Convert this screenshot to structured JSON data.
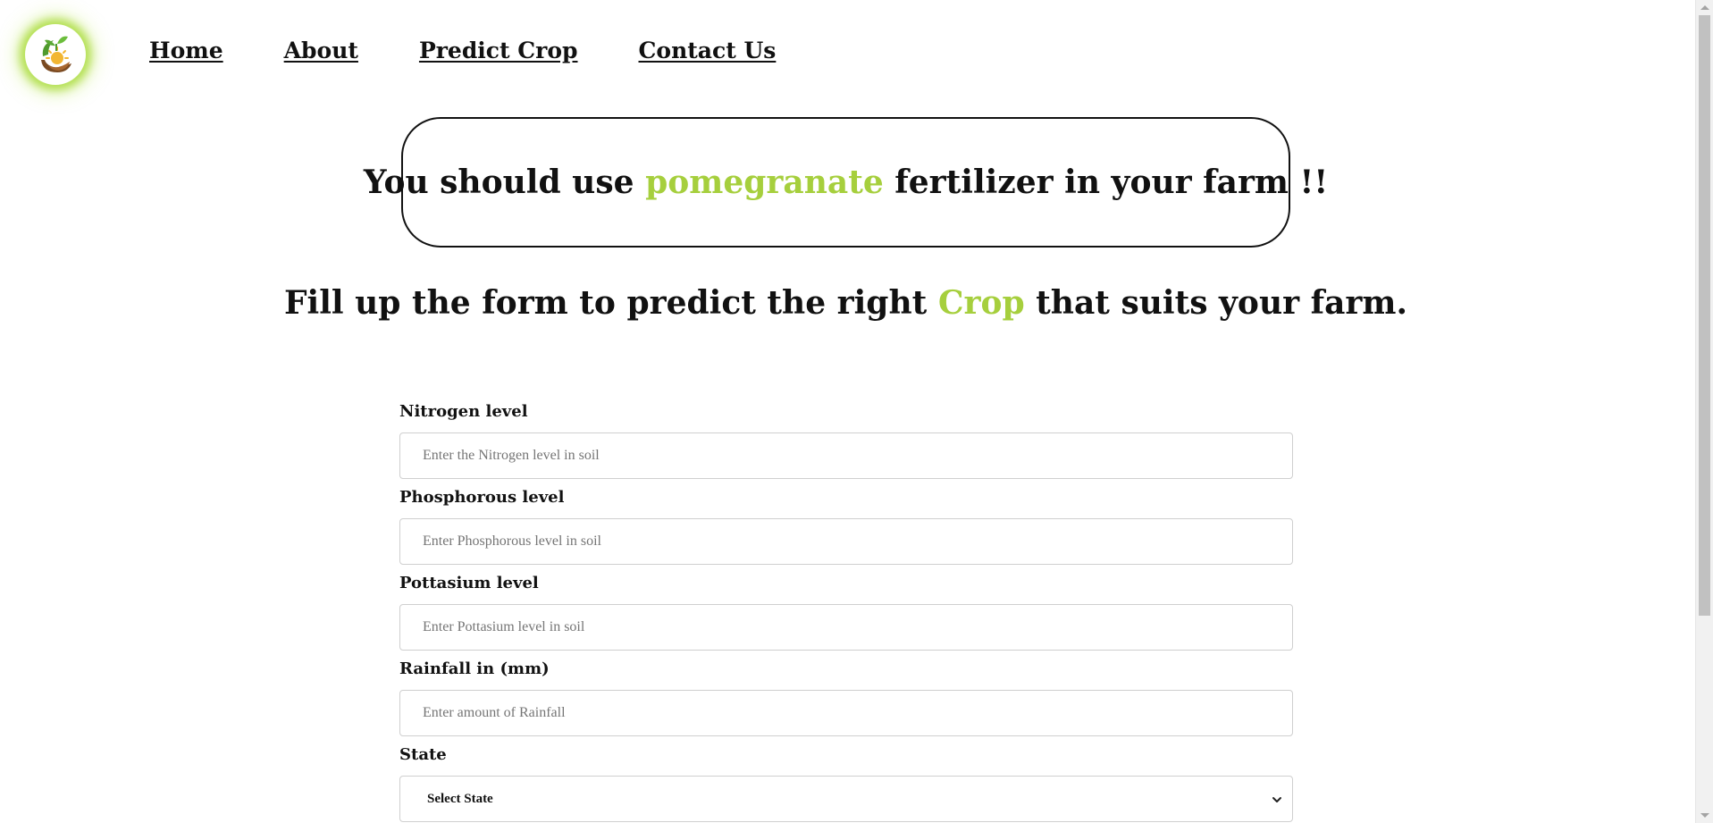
{
  "nav": {
    "items": [
      {
        "label": "Home"
      },
      {
        "label": "About"
      },
      {
        "label": "Predict Crop"
      },
      {
        "label": "Contact Us"
      }
    ]
  },
  "result": {
    "prefix": "You should use ",
    "highlight": "pomegranate",
    "suffix": " fertilizer in your farm !!"
  },
  "heading": {
    "prefix": "Fill up the form to predict the right ",
    "highlight": "Crop",
    "suffix": " that suits your farm."
  },
  "form": {
    "fields": [
      {
        "label": "Nitrogen level",
        "placeholder": "Enter the Nitrogen level in soil",
        "value": ""
      },
      {
        "label": "Phosphorous level",
        "placeholder": "Enter Phosphorous level in soil",
        "value": ""
      },
      {
        "label": "Pottasium level",
        "placeholder": "Enter Pottasium level in soil",
        "value": ""
      },
      {
        "label": "Rainfall in (mm)",
        "placeholder": "Enter amount of Rainfall",
        "value": ""
      }
    ],
    "state": {
      "label": "State",
      "selected": "Select State"
    }
  },
  "colors": {
    "accent": "#a6cf3d",
    "logo_glow": "#a0d728",
    "text": "#111111"
  },
  "icons": {
    "logo": "plant-sun-hands-logo",
    "select": "chevron-down-icon"
  }
}
